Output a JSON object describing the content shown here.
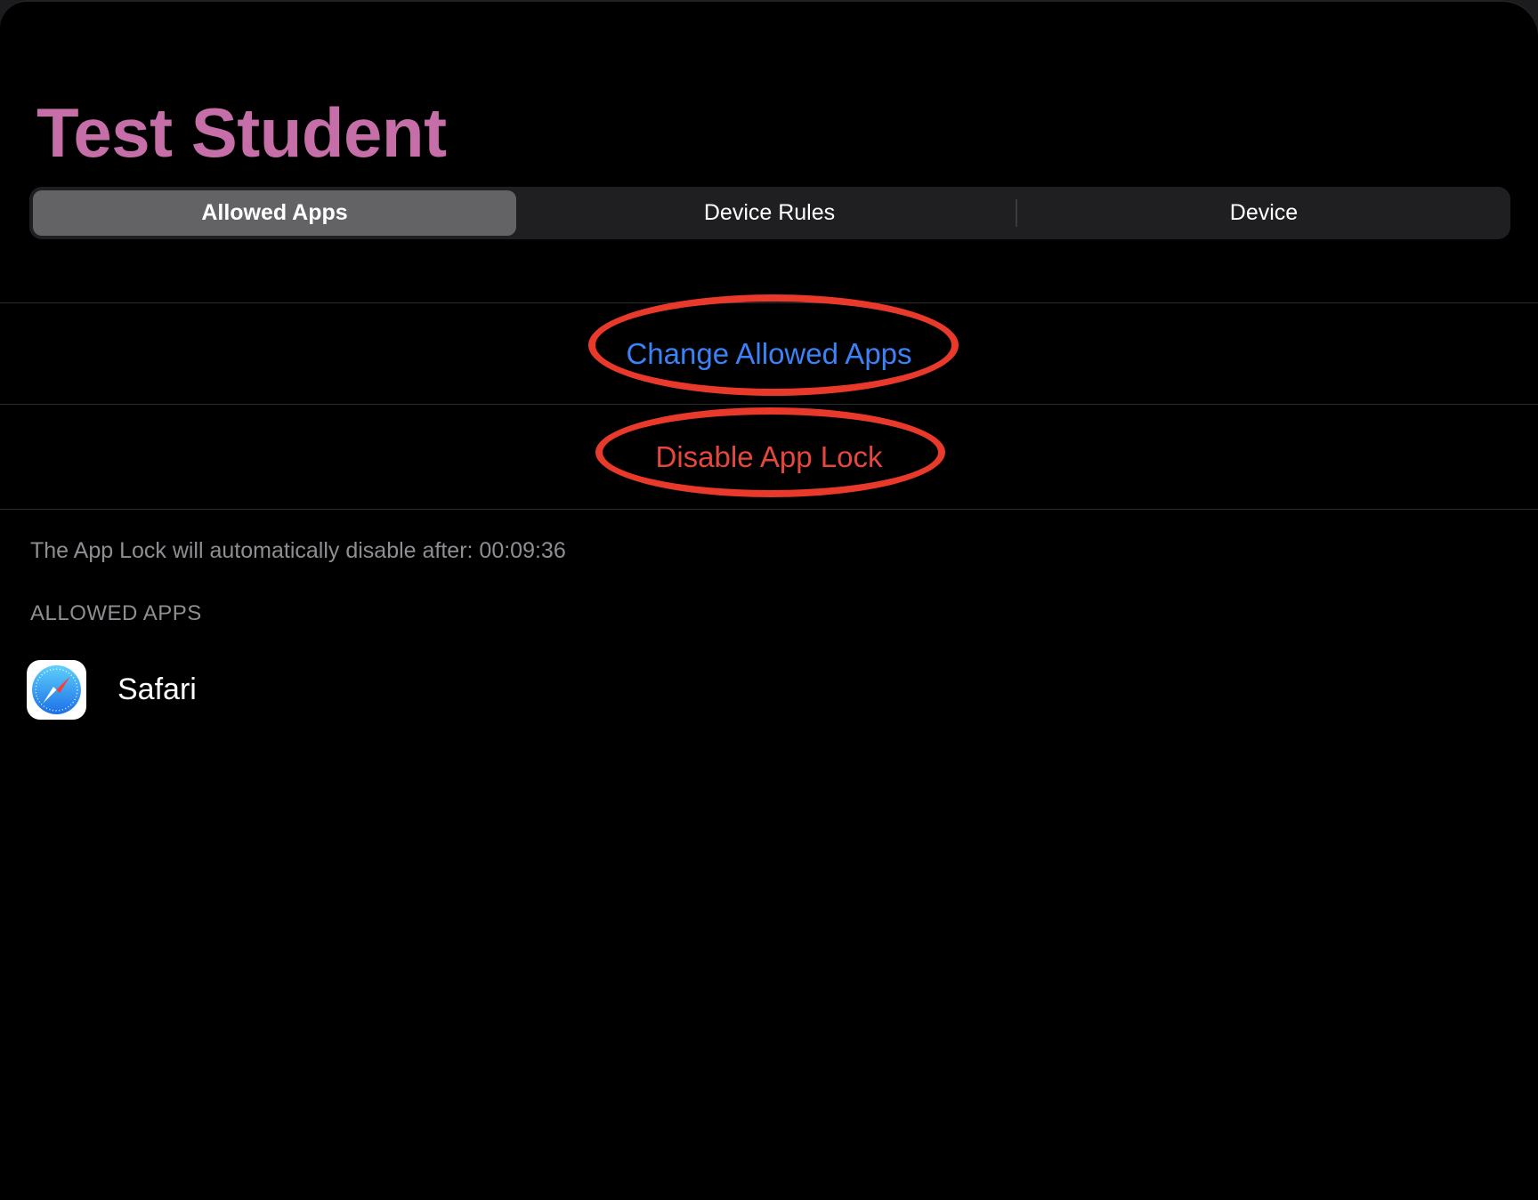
{
  "header": {
    "title": "Test Student"
  },
  "tabs": [
    {
      "label": "Allowed Apps",
      "selected": true
    },
    {
      "label": "Device Rules",
      "selected": false
    },
    {
      "label": "Device",
      "selected": false
    }
  ],
  "actions": {
    "change_allowed_apps": "Change Allowed Apps",
    "disable_app_lock": "Disable App Lock"
  },
  "app_lock": {
    "countdown_text": "The App Lock will automatically disable after: 00:09:36"
  },
  "allowed_apps": {
    "section_header": "ALLOWED APPS",
    "items": [
      {
        "name": "Safari",
        "icon": "safari-compass-icon"
      }
    ]
  },
  "colors": {
    "title": "#c56ea8",
    "link_blue": "#3b82f6",
    "destructive_red": "#e5473c",
    "annotation_red": "#e8392a",
    "background": "#000000"
  }
}
